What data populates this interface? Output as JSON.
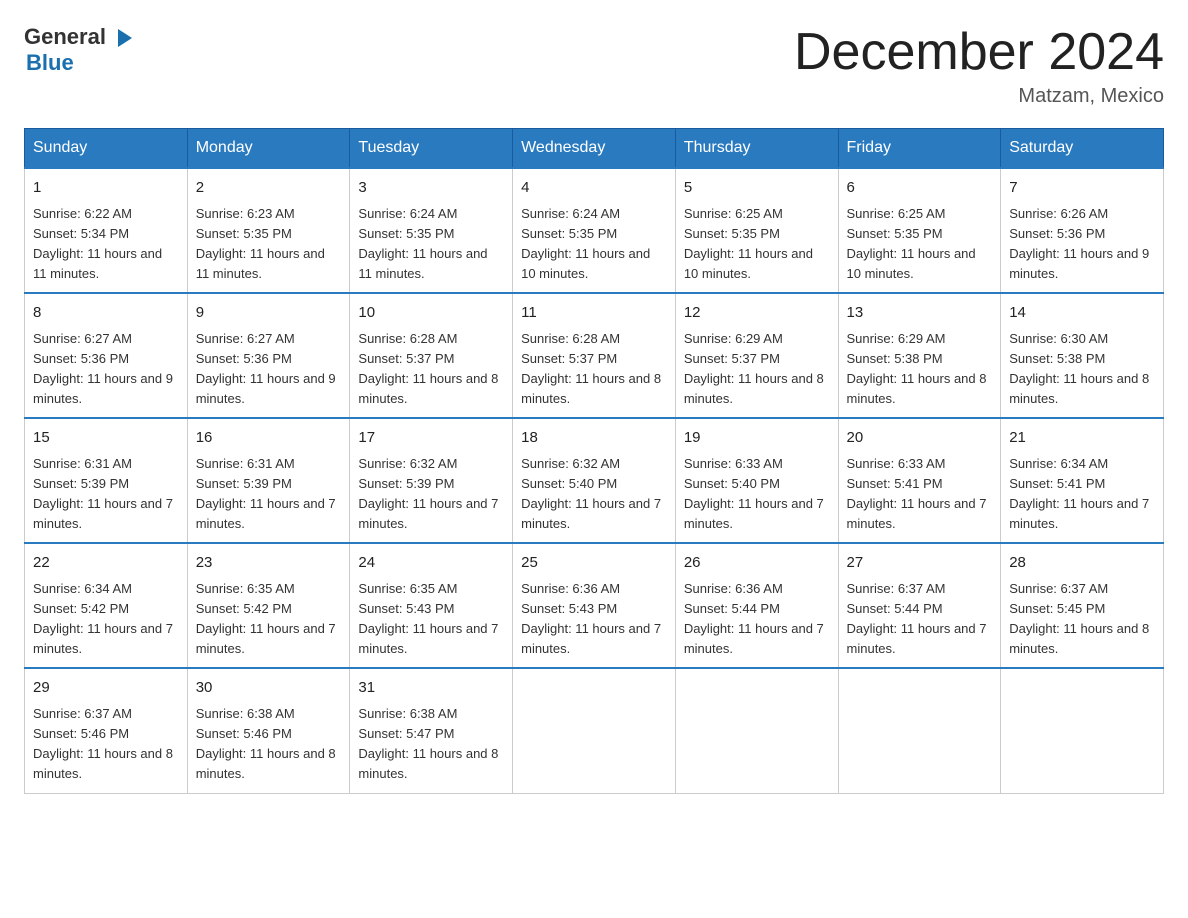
{
  "header": {
    "logo_general": "General",
    "logo_blue": "Blue",
    "month_title": "December 2024",
    "location": "Matzam, Mexico"
  },
  "days_of_week": [
    "Sunday",
    "Monday",
    "Tuesday",
    "Wednesday",
    "Thursday",
    "Friday",
    "Saturday"
  ],
  "weeks": [
    [
      {
        "day": "1",
        "sunrise": "6:22 AM",
        "sunset": "5:34 PM",
        "daylight": "11 hours and 11 minutes."
      },
      {
        "day": "2",
        "sunrise": "6:23 AM",
        "sunset": "5:35 PM",
        "daylight": "11 hours and 11 minutes."
      },
      {
        "day": "3",
        "sunrise": "6:24 AM",
        "sunset": "5:35 PM",
        "daylight": "11 hours and 11 minutes."
      },
      {
        "day": "4",
        "sunrise": "6:24 AM",
        "sunset": "5:35 PM",
        "daylight": "11 hours and 10 minutes."
      },
      {
        "day": "5",
        "sunrise": "6:25 AM",
        "sunset": "5:35 PM",
        "daylight": "11 hours and 10 minutes."
      },
      {
        "day": "6",
        "sunrise": "6:25 AM",
        "sunset": "5:35 PM",
        "daylight": "11 hours and 10 minutes."
      },
      {
        "day": "7",
        "sunrise": "6:26 AM",
        "sunset": "5:36 PM",
        "daylight": "11 hours and 9 minutes."
      }
    ],
    [
      {
        "day": "8",
        "sunrise": "6:27 AM",
        "sunset": "5:36 PM",
        "daylight": "11 hours and 9 minutes."
      },
      {
        "day": "9",
        "sunrise": "6:27 AM",
        "sunset": "5:36 PM",
        "daylight": "11 hours and 9 minutes."
      },
      {
        "day": "10",
        "sunrise": "6:28 AM",
        "sunset": "5:37 PM",
        "daylight": "11 hours and 8 minutes."
      },
      {
        "day": "11",
        "sunrise": "6:28 AM",
        "sunset": "5:37 PM",
        "daylight": "11 hours and 8 minutes."
      },
      {
        "day": "12",
        "sunrise": "6:29 AM",
        "sunset": "5:37 PM",
        "daylight": "11 hours and 8 minutes."
      },
      {
        "day": "13",
        "sunrise": "6:29 AM",
        "sunset": "5:38 PM",
        "daylight": "11 hours and 8 minutes."
      },
      {
        "day": "14",
        "sunrise": "6:30 AM",
        "sunset": "5:38 PM",
        "daylight": "11 hours and 8 minutes."
      }
    ],
    [
      {
        "day": "15",
        "sunrise": "6:31 AM",
        "sunset": "5:39 PM",
        "daylight": "11 hours and 7 minutes."
      },
      {
        "day": "16",
        "sunrise": "6:31 AM",
        "sunset": "5:39 PM",
        "daylight": "11 hours and 7 minutes."
      },
      {
        "day": "17",
        "sunrise": "6:32 AM",
        "sunset": "5:39 PM",
        "daylight": "11 hours and 7 minutes."
      },
      {
        "day": "18",
        "sunrise": "6:32 AM",
        "sunset": "5:40 PM",
        "daylight": "11 hours and 7 minutes."
      },
      {
        "day": "19",
        "sunrise": "6:33 AM",
        "sunset": "5:40 PM",
        "daylight": "11 hours and 7 minutes."
      },
      {
        "day": "20",
        "sunrise": "6:33 AM",
        "sunset": "5:41 PM",
        "daylight": "11 hours and 7 minutes."
      },
      {
        "day": "21",
        "sunrise": "6:34 AM",
        "sunset": "5:41 PM",
        "daylight": "11 hours and 7 minutes."
      }
    ],
    [
      {
        "day": "22",
        "sunrise": "6:34 AM",
        "sunset": "5:42 PM",
        "daylight": "11 hours and 7 minutes."
      },
      {
        "day": "23",
        "sunrise": "6:35 AM",
        "sunset": "5:42 PM",
        "daylight": "11 hours and 7 minutes."
      },
      {
        "day": "24",
        "sunrise": "6:35 AM",
        "sunset": "5:43 PM",
        "daylight": "11 hours and 7 minutes."
      },
      {
        "day": "25",
        "sunrise": "6:36 AM",
        "sunset": "5:43 PM",
        "daylight": "11 hours and 7 minutes."
      },
      {
        "day": "26",
        "sunrise": "6:36 AM",
        "sunset": "5:44 PM",
        "daylight": "11 hours and 7 minutes."
      },
      {
        "day": "27",
        "sunrise": "6:37 AM",
        "sunset": "5:44 PM",
        "daylight": "11 hours and 7 minutes."
      },
      {
        "day": "28",
        "sunrise": "6:37 AM",
        "sunset": "5:45 PM",
        "daylight": "11 hours and 8 minutes."
      }
    ],
    [
      {
        "day": "29",
        "sunrise": "6:37 AM",
        "sunset": "5:46 PM",
        "daylight": "11 hours and 8 minutes."
      },
      {
        "day": "30",
        "sunrise": "6:38 AM",
        "sunset": "5:46 PM",
        "daylight": "11 hours and 8 minutes."
      },
      {
        "day": "31",
        "sunrise": "6:38 AM",
        "sunset": "5:47 PM",
        "daylight": "11 hours and 8 minutes."
      },
      null,
      null,
      null,
      null
    ]
  ]
}
